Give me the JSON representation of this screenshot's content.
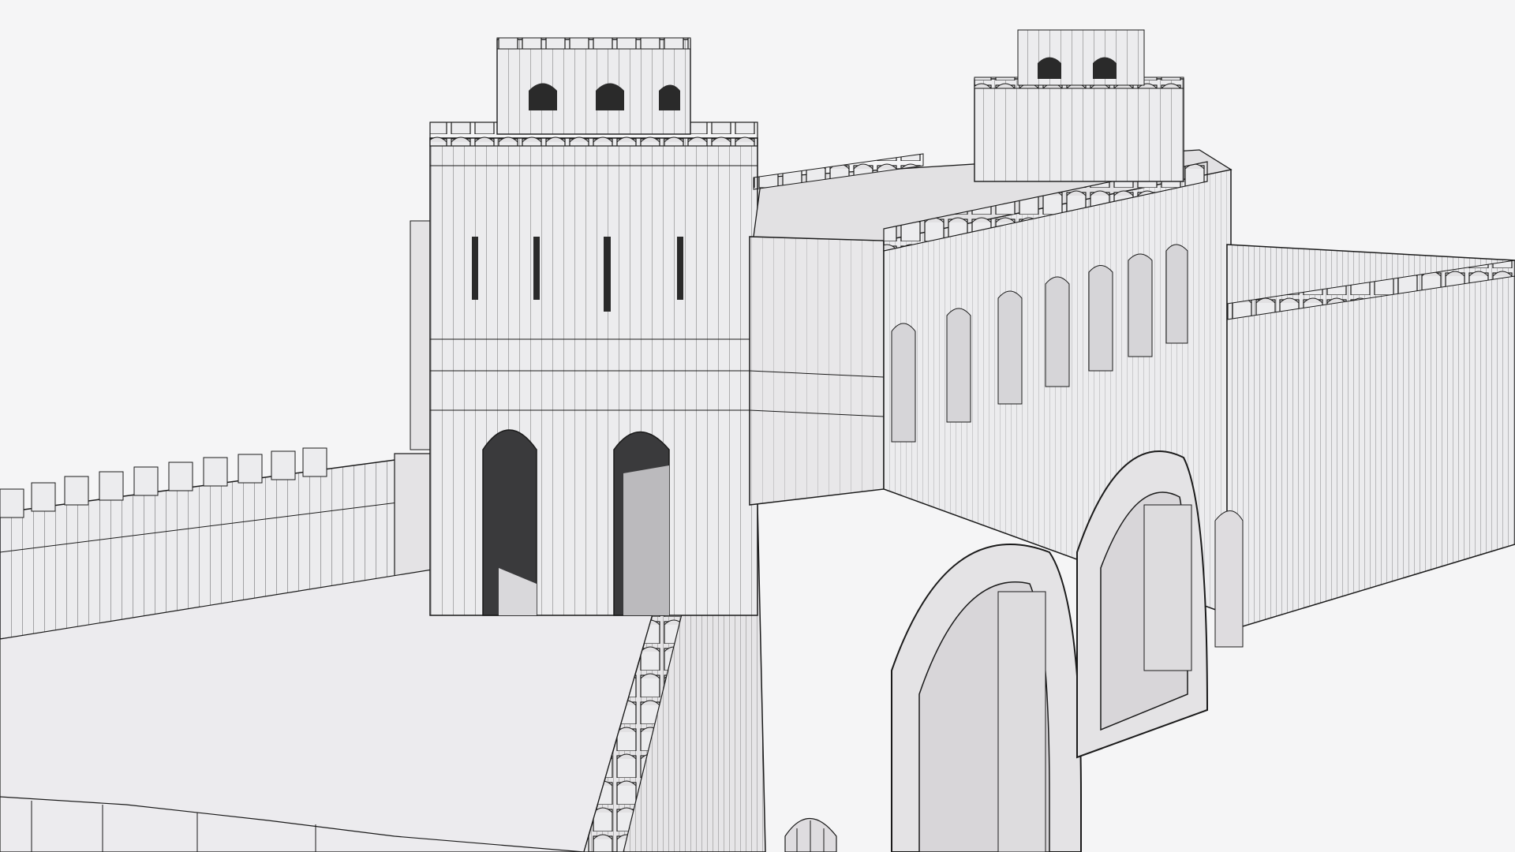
{
  "scene": {
    "subject": "wireframe-render-of-fortress-gate",
    "background_color": "#f5f5f6",
    "surface_color": "#ececee",
    "shadow_color": "#d4d2d4",
    "wire_color": "#1a1a1a",
    "opening_color": "#2a2a2a"
  }
}
